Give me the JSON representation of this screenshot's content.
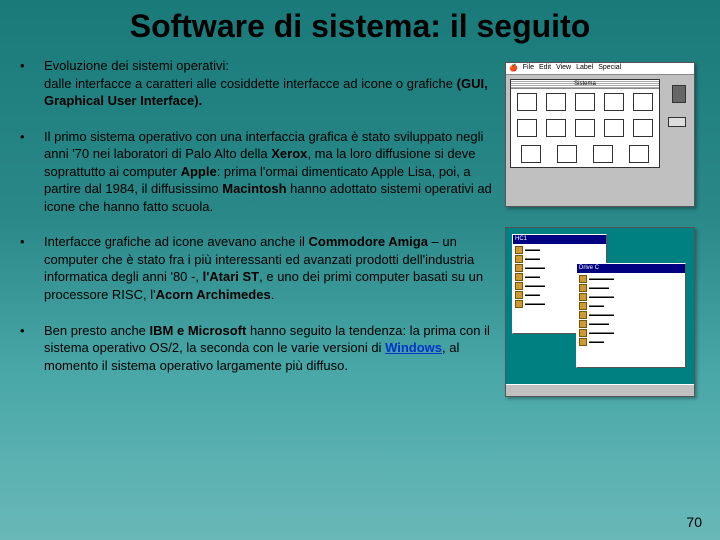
{
  "title": "Software di sistema: il seguito",
  "bullets": {
    "b1a": "Evoluzione dei sistemi operativi:",
    "b1b": "dalle interfacce a caratteri alle cosiddette interfacce ad icone o grafiche ",
    "b1c": "(GUI, Graphical User Interface).",
    "b2a": "Il primo sistema operativo con una interfaccia grafica è stato sviluppato negli anni '70 nei laboratori di Palo Alto della ",
    "b2b": "Xerox",
    "b2c": ", ma la loro diffusione si deve soprattutto ai computer ",
    "b2d": "Apple",
    "b2e": ": prima l'ormai dimenticato Apple Lisa, poi, a partire dal 1984, il diffusissimo ",
    "b2f": "Macintosh",
    "b2g": " hanno adottato sistemi operativi ad icone che hanno fatto scuola.",
    "b3a": "Interfacce grafiche ad icone avevano anche il ",
    "b3b": "Commodore Amiga",
    "b3c": " – un computer che è stato fra i più interessanti ed avanzati prodotti dell'industria informatica degli anni '80 -, ",
    "b3d": "l'Atari ST",
    "b3e": ", e uno dei primi computer basati su un processore RISC, l'",
    "b3f": "Acorn Archimedes",
    "b3g": ".",
    "b4a": "Ben presto anche ",
    "b4b": "IBM e Microsoft",
    "b4c": " hanno seguito la tendenza: la prima con il sistema operativo OS/2, la seconda con le varie versioni di ",
    "b4d": "Windows",
    "b4e": ", al momento il sistema operativo largamente più diffuso."
  },
  "pagenum": "70",
  "fig1": {
    "menu": [
      "File",
      "Edit",
      "View",
      "Label",
      "Special"
    ],
    "wintitle": "Sistema"
  },
  "fig2": {
    "wintitle1": "HC1",
    "wintitle2": "Drive C"
  }
}
